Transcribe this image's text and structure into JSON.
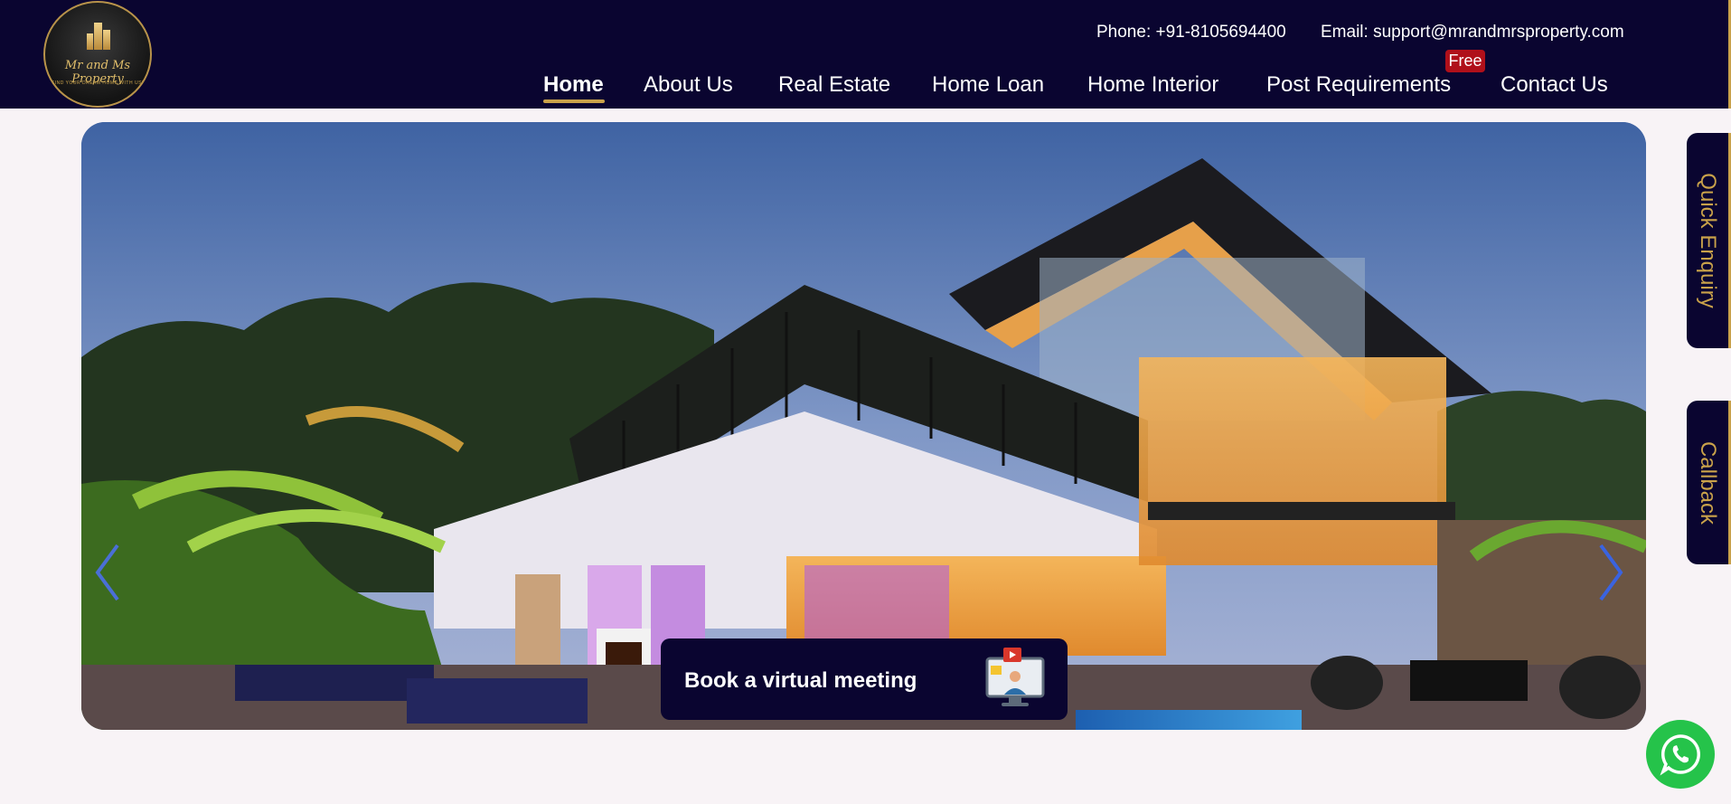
{
  "brand": {
    "logo_text": "Mr and Ms Property",
    "logo_tagline": "FIND YOUR DREAM HOME WITH US!",
    "colors": {
      "navy": "#0a0530",
      "gold": "#c9a24a",
      "badge_red": "#b0101a",
      "whatsapp_green": "#25c34a"
    }
  },
  "header": {
    "phone": "Phone: +91-8105694400",
    "email": "Email: support@mrandmrsproperty.com"
  },
  "nav": {
    "items": [
      {
        "label": "Home",
        "active": true
      },
      {
        "label": "About Us"
      },
      {
        "label": "Real Estate"
      },
      {
        "label": "Home Loan"
      },
      {
        "label": "Home Interior"
      },
      {
        "label": "Post Requirements",
        "badge": "Free"
      },
      {
        "label": "Contact Us"
      }
    ]
  },
  "hero": {
    "carousel": {
      "prev_icon": "chevron-left-icon",
      "next_icon": "chevron-right-icon"
    },
    "cta": {
      "label": "Book a virtual meeting",
      "icon": "video-meeting-icon"
    }
  },
  "side_tabs": {
    "quick_enquiry": "Quick Enquiry",
    "callback": "Callback"
  },
  "floating": {
    "whatsapp_icon": "whatsapp-icon"
  }
}
